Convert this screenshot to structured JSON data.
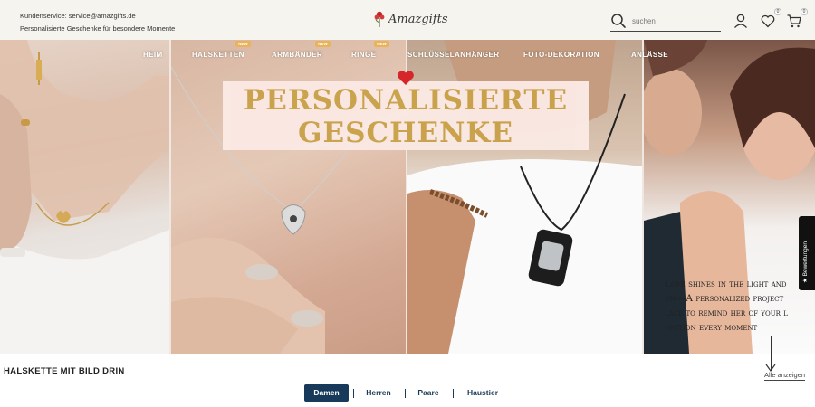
{
  "header": {
    "service_text": "Kundenservice: service@amazgifts.de",
    "tagline": "Personalisierte Geschenke für besondere Momente",
    "logo_text": "Amazgifts",
    "search_placeholder": "suchen",
    "wishlist_count": "0",
    "cart_count": "0",
    "icons": [
      "search-icon",
      "user-icon",
      "heart-icon",
      "cart-icon"
    ]
  },
  "nav": {
    "items": [
      {
        "label": "HEIM",
        "new": false
      },
      {
        "label": "HALSKETTEN",
        "new": true
      },
      {
        "label": "ARMBÄNDER",
        "new": true
      },
      {
        "label": "RINGE",
        "new": true
      },
      {
        "label": "SCHLÜSSELANHÄNGER",
        "new": false
      },
      {
        "label": "FOTO-DEKORATION",
        "new": false
      },
      {
        "label": "ANLÄSSE",
        "new": false
      }
    ],
    "new_badge": "NEW"
  },
  "hero": {
    "title_line1": "PERSONALISIERTE",
    "title_line2": "GESCHENKE",
    "side_text": "Love shines in the light and\now—A personalized project\nlace to remind her of your l\nfection every moment",
    "reviews_tab": "★ Bewertungen"
  },
  "section": {
    "title": "HALSKETTE MIT BILD DRIN",
    "view_all": "Alle anzeigen",
    "tabs": [
      {
        "label": "Damen",
        "active": true
      },
      {
        "label": "Herren",
        "active": false
      },
      {
        "label": "Paare",
        "active": false
      },
      {
        "label": "Haustier",
        "active": false
      }
    ]
  },
  "colors": {
    "accent": "#173a5a",
    "title_gold": "#caa24a",
    "heart_red": "#d7262b",
    "header_bg": "#f5f4ef"
  }
}
